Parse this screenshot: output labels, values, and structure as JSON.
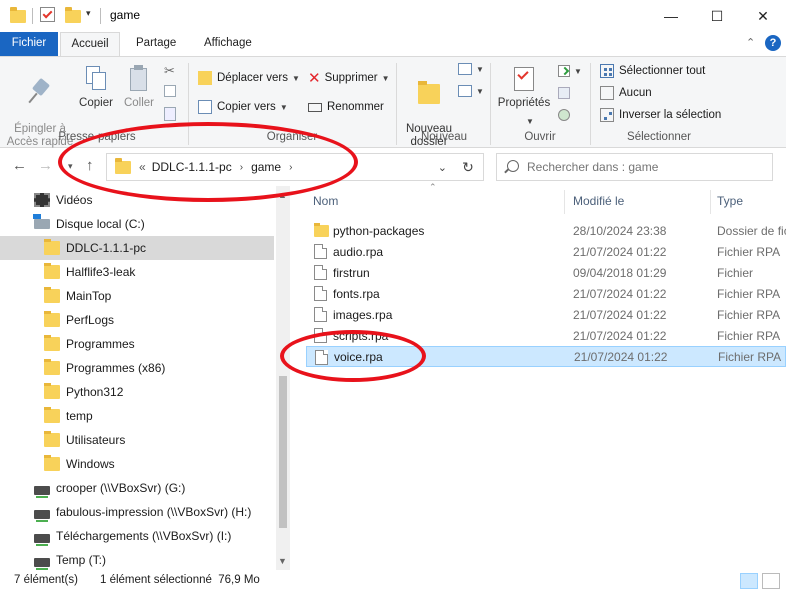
{
  "window": {
    "title": "game",
    "minimize_glyph": "—",
    "maximize_glyph": "☐",
    "close_glyph": "✕"
  },
  "ribbon_tabs": {
    "file": "Fichier",
    "home": "Accueil",
    "share": "Partage",
    "view": "Affichage",
    "help_glyph": "?"
  },
  "ribbon": {
    "pin": "Épingler à\nAccès rapide",
    "copy": "Copier",
    "paste": "Coller",
    "clipboard_group": "Presse-papiers",
    "move_to": "Déplacer vers",
    "copy_to": "Copier vers",
    "delete": "Supprimer",
    "rename": "Renommer",
    "organize_group": "Organiser",
    "new_folder": "Nouveau\ndossier",
    "new_group": "Nouveau",
    "properties": "Propriétés",
    "open_group": "Ouvrir",
    "select_all": "Sélectionner tout",
    "select_none": "Aucun",
    "invert_selection": "Inverser la sélection",
    "select_group": "Sélectionner"
  },
  "address": {
    "overflow": "«",
    "crumbs": [
      "DDLC-1.1.1-pc",
      "game"
    ],
    "search_placeholder": "Rechercher dans : game"
  },
  "nav_items": [
    {
      "label": "Vidéos",
      "icon": "video-folder-icon"
    },
    {
      "label": "Disque local (C:)",
      "icon": "local-disk-icon"
    },
    {
      "label": "DDLC-1.1.1-pc",
      "icon": "folder-icon",
      "selected": true
    },
    {
      "label": "Halflife3-leak",
      "icon": "folder-icon"
    },
    {
      "label": "MainTop",
      "icon": "folder-icon"
    },
    {
      "label": "PerfLogs",
      "icon": "folder-icon"
    },
    {
      "label": "Programmes",
      "icon": "folder-icon"
    },
    {
      "label": "Programmes (x86)",
      "icon": "folder-icon"
    },
    {
      "label": "Python312",
      "icon": "folder-icon"
    },
    {
      "label": "temp",
      "icon": "folder-icon"
    },
    {
      "label": "Utilisateurs",
      "icon": "folder-icon"
    },
    {
      "label": "Windows",
      "icon": "folder-icon"
    },
    {
      "label": "crooper (\\\\VBoxSvr) (G:)",
      "icon": "network-drive-icon"
    },
    {
      "label": "fabulous-impression (\\\\VBoxSvr) (H:)",
      "icon": "network-drive-icon"
    },
    {
      "label": "Téléchargements (\\\\VBoxSvr) (I:)",
      "icon": "network-drive-icon"
    },
    {
      "label": "Temp (T:)",
      "icon": "network-drive-icon"
    }
  ],
  "columns": {
    "name": "Nom",
    "modified": "Modifié le",
    "type": "Type"
  },
  "files": [
    {
      "name": "python-packages",
      "date": "28/10/2024 23:38",
      "type": "Dossier de fic",
      "kind": "folder"
    },
    {
      "name": "audio.rpa",
      "date": "21/07/2024 01:22",
      "type": "Fichier RPA",
      "kind": "file"
    },
    {
      "name": "firstrun",
      "date": "09/04/2018 01:29",
      "type": "Fichier",
      "kind": "file"
    },
    {
      "name": "fonts.rpa",
      "date": "21/07/2024 01:22",
      "type": "Fichier RPA",
      "kind": "file"
    },
    {
      "name": "images.rpa",
      "date": "21/07/2024 01:22",
      "type": "Fichier RPA",
      "kind": "file"
    },
    {
      "name": "scripts.rpa",
      "date": "21/07/2024 01:22",
      "type": "Fichier RPA",
      "kind": "file"
    },
    {
      "name": "voice.rpa",
      "date": "21/07/2024 01:22",
      "type": "Fichier RPA",
      "kind": "file",
      "selected": true
    }
  ],
  "status": {
    "count": "7 élément(s)",
    "selection": "1 élément sélectionné  76,9 Mo"
  },
  "colors": {
    "accent": "#1a66c2",
    "selection": "#cce8ff",
    "annotation": "#e8121b"
  }
}
